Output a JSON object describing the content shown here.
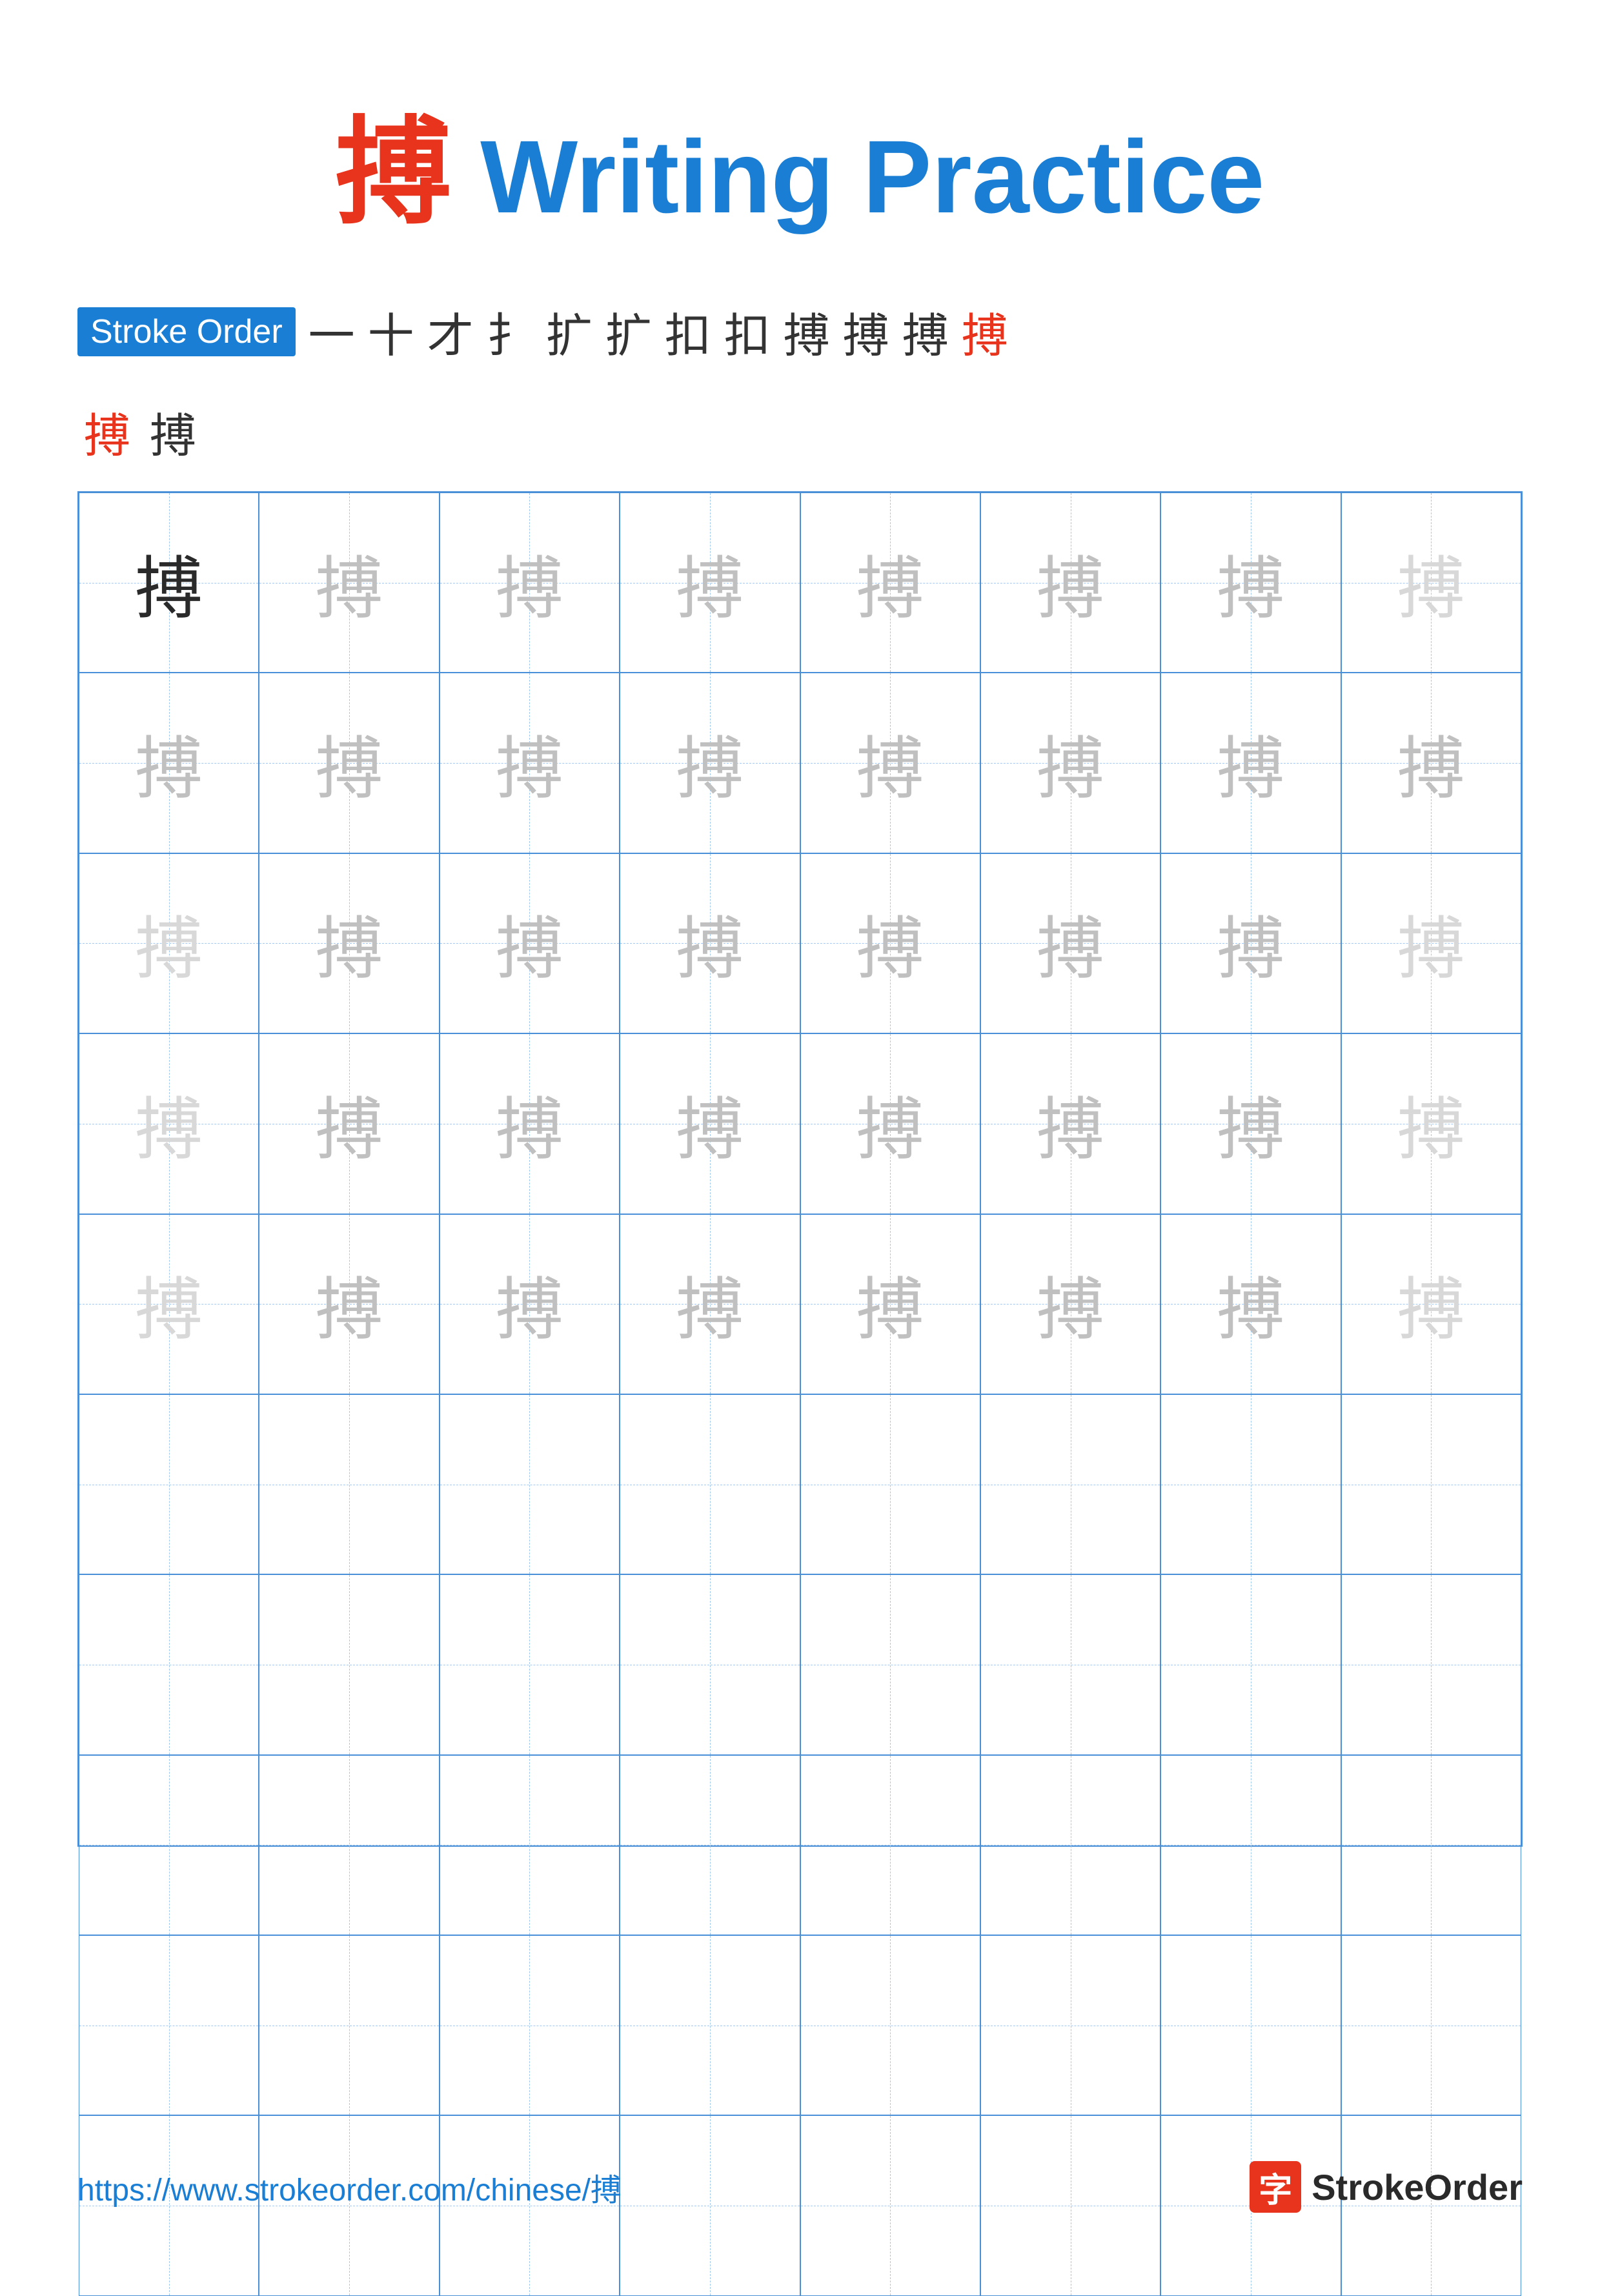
{
  "title": {
    "char": "搏",
    "text": " Writing Practice"
  },
  "strokeOrder": {
    "badge": "Stroke Order",
    "chars": [
      "一",
      "十",
      "才",
      "扌",
      "扩",
      "扩",
      "扣",
      "扣",
      "搏",
      "搏",
      "搏",
      "搏"
    ],
    "extraRow": [
      "搏",
      "搏"
    ]
  },
  "grid": {
    "rows": 10,
    "cols": 8,
    "mainChar": "搏",
    "cells": [
      "dark",
      "medium",
      "medium",
      "medium",
      "medium",
      "medium",
      "medium",
      "light",
      "medium",
      "medium",
      "medium",
      "medium",
      "medium",
      "medium",
      "medium",
      "medium",
      "light",
      "medium",
      "medium",
      "medium",
      "medium",
      "medium",
      "medium",
      "light",
      "light",
      "medium",
      "medium",
      "medium",
      "medium",
      "medium",
      "medium",
      "light",
      "light",
      "medium",
      "medium",
      "medium",
      "medium",
      "medium",
      "medium",
      "light",
      "empty",
      "empty",
      "empty",
      "empty",
      "empty",
      "empty",
      "empty",
      "empty",
      "empty",
      "empty",
      "empty",
      "empty",
      "empty",
      "empty",
      "empty",
      "empty",
      "empty",
      "empty",
      "empty",
      "empty",
      "empty",
      "empty",
      "empty",
      "empty",
      "empty",
      "empty",
      "empty",
      "empty",
      "empty",
      "empty",
      "empty",
      "empty",
      "empty",
      "empty",
      "empty",
      "empty",
      "empty",
      "empty",
      "empty",
      "empty"
    ]
  },
  "footer": {
    "url": "https://www.strokeorder.com/chinese/搏",
    "logoChar": "字",
    "logoText": "StrokeOrder"
  }
}
